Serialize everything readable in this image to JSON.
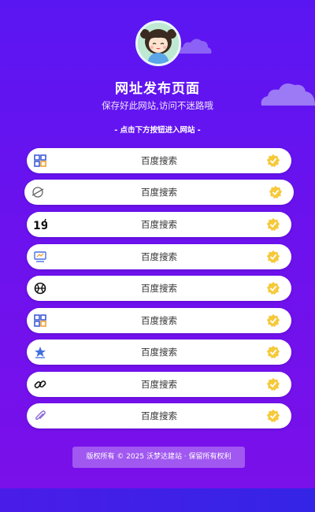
{
  "header": {
    "title": "网址发布页面",
    "subtitle": "保存好此网站,访问不迷路哦",
    "hint": "- 点击下方按钮进入网站 -"
  },
  "links": [
    {
      "label": "百度搜索",
      "icon": "grid-apps-icon"
    },
    {
      "label": "百度搜索",
      "icon": "planet-icon"
    },
    {
      "label": "百度搜索",
      "icon": "number-19-icon"
    },
    {
      "label": "百度搜索",
      "icon": "monitor-chart-icon"
    },
    {
      "label": "百度搜索",
      "icon": "basketball-icon"
    },
    {
      "label": "百度搜索",
      "icon": "grid-apps-icon"
    },
    {
      "label": "百度搜索",
      "icon": "star-badge-icon"
    },
    {
      "label": "百度搜索",
      "icon": "chain-link-icon"
    },
    {
      "label": "百度搜索",
      "icon": "paperclip-icon"
    }
  ],
  "footer": {
    "text": "版权所有 © 2025 沃梦达建站 · 保留所有权利"
  },
  "colors": {
    "background_top": "#5a16f2",
    "background_bottom": "#7a10ea",
    "button": "#ffffff",
    "check_badge": "#f6c93a"
  }
}
